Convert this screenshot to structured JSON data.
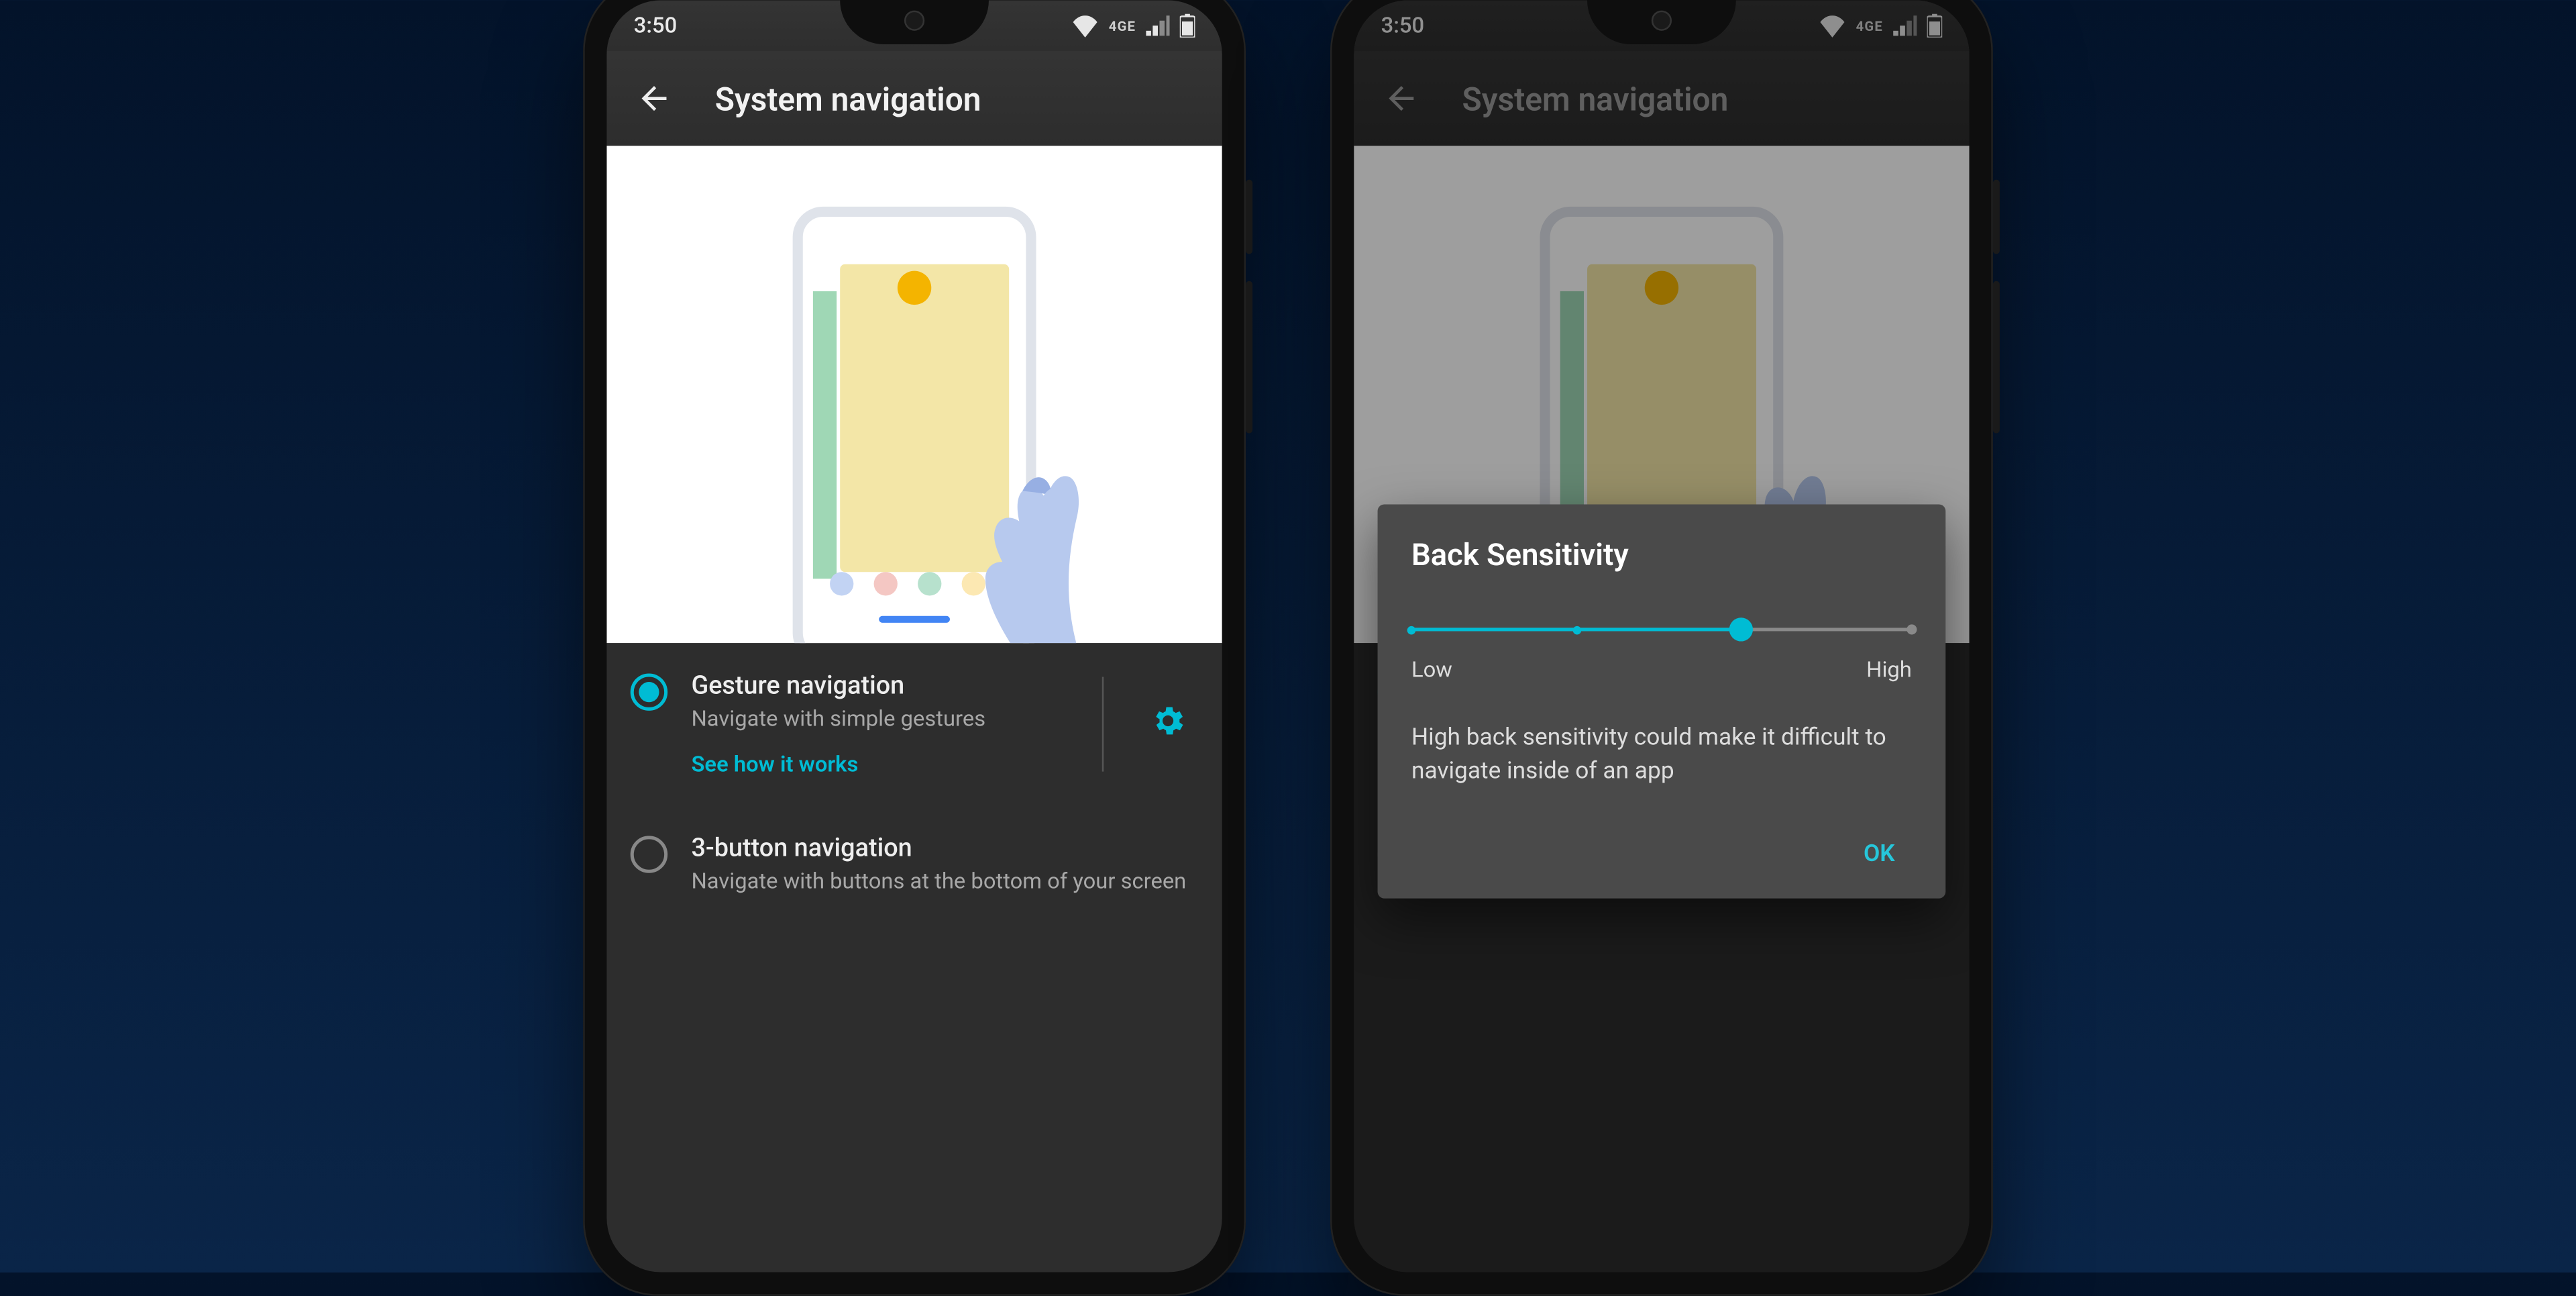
{
  "status": {
    "time": "3:50",
    "network": "4GE"
  },
  "appbar": {
    "title": "System navigation"
  },
  "options": {
    "gesture": {
      "title": "Gesture navigation",
      "subtitle": "Navigate with simple gestures",
      "link": "See how it works"
    },
    "three_button": {
      "title": "3-button navigation",
      "subtitle": "Navigate with buttons at the bottom of your screen"
    }
  },
  "dialog": {
    "title": "Back Sensitivity",
    "low": "Low",
    "high": "High",
    "message": "High back sensitivity could make it difficult to navigate inside of an app",
    "ok": "OK",
    "value_percent": 66
  }
}
